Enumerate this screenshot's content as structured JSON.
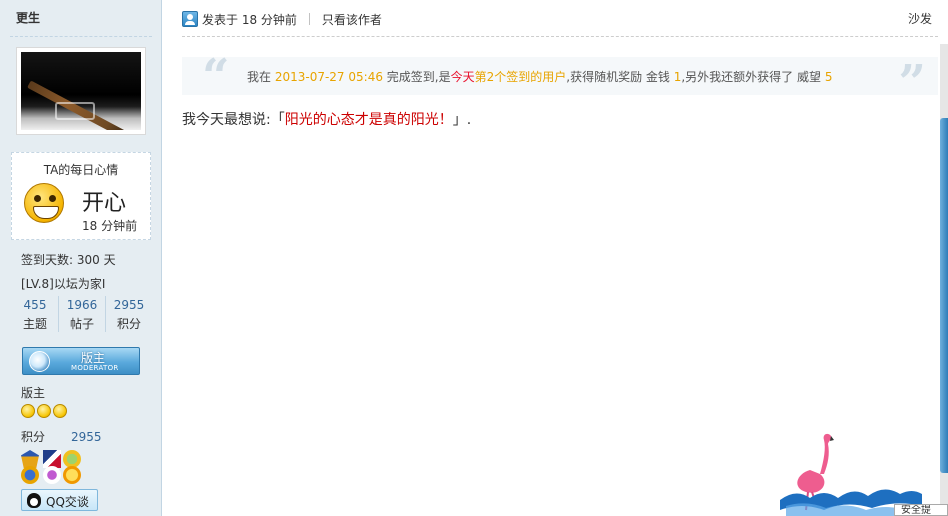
{
  "user": {
    "name": "更生",
    "mood_title": "TA的每日心情",
    "mood": "开心",
    "mood_time": "18 分钟前",
    "checkin_days": "签到天数: 300 天",
    "level": "[LV.8]以坛为家I",
    "stats": [
      {
        "value": "455",
        "label": "主题"
      },
      {
        "value": "1966",
        "label": "帖子"
      },
      {
        "value": "2955",
        "label": "积分"
      }
    ],
    "badge_cn": "版主",
    "badge_en": "MODERATOR",
    "group": "版主",
    "star_count": 3,
    "points_label": "积分",
    "points_value": "2955",
    "qq_label": "QQ交谈"
  },
  "post": {
    "posted": "发表于 18 分钟前",
    "author_only": "只看该作者",
    "floor": "沙发",
    "quote": {
      "p1": "我在 ",
      "date": "2013-07-27 05:46",
      "p2": " 完成签到,是",
      "today": "今天",
      "rank": "第2个签到的用户",
      "p3": ",获得随机奖励 金钱 ",
      "money": "1",
      "p4": ",另外我还额外获得了 威望 ",
      "rep": "5"
    },
    "mood_prefix": "我今天最想说:「",
    "mood_quote": "阳光的心态才是真的阳光！",
    "mood_suffix": "」."
  },
  "corner_text": "安全提",
  "icons": {
    "open_quote": "“",
    "close_quote": "”"
  },
  "colors": {
    "highlight_orange": "#e8a400",
    "highlight_red": "#e8112d",
    "link_blue": "#336699",
    "sidebar_bg": "#e5edf2"
  }
}
